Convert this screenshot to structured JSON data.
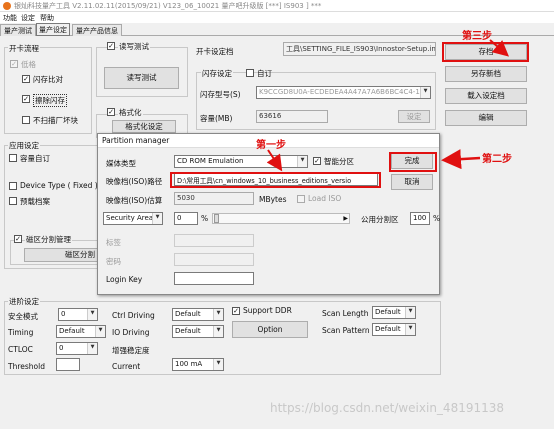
{
  "window": {
    "title": "银灿科技量产工具 V2.11.02.11(2015/09/21)  V123_06_10021 量产吧升级版           [***] IS903 ] ***"
  },
  "menu": [
    "功能",
    "设定",
    "帮助"
  ],
  "tabs": [
    "量产测试",
    "量产设定",
    "量产产品信息"
  ],
  "card_group": {
    "title": "开卡流程",
    "items": [
      {
        "label": "低格",
        "checked": true,
        "disabled": true
      },
      {
        "label": "闪存比对",
        "checked": true
      },
      {
        "label": "擦除闪存",
        "checked": true
      },
      {
        "label": "不扫描厂坏块",
        "checked": false
      }
    ]
  },
  "read_test": {
    "checkbox": "读写测试",
    "checked": true,
    "button": "读写测试"
  },
  "format": {
    "checkbox": "格式化",
    "checked": true,
    "button": "格式化设定"
  },
  "app": {
    "title": "应用设定",
    "items": [
      "容量自订",
      "Device Type ( Fixed )",
      "预载档案"
    ]
  },
  "partition": {
    "checkbox": "磁区分割管理",
    "checked": true,
    "button": "磁区分割"
  },
  "settings_file": {
    "label": "开卡设定档",
    "value": "工具\\SETTING_FILE_IS903\\Innostor-Setup.ini"
  },
  "flash": {
    "title": "闪存设定",
    "custom": "自订",
    "model_label": "闪存型号(S)",
    "model_value": "K9CCGD8U0A-ECDEDEA4A47A7A6B6BC4C4-1",
    "capacity_label": "容量(MB)",
    "capacity_value": "63616",
    "setup_button": "设定"
  },
  "right_buttons": {
    "save": "存档",
    "save_as": "另存新档",
    "load": "载入设定档",
    "edit": "编辑"
  },
  "adv": {
    "title": "进阶设定",
    "security_mode": {
      "label": "安全模式",
      "value": "0"
    },
    "timing": {
      "label": "Timing",
      "value": "Default"
    },
    "ctloc": {
      "label": "CTLOC",
      "value": "0"
    },
    "threshold": {
      "label": "Threshold",
      "value": ""
    },
    "ctrl_driving": {
      "label": "Ctrl Driving",
      "value": "Default"
    },
    "io_driving": {
      "label": "IO Driving",
      "value": "Default"
    },
    "stability": {
      "label": "增强稳定度"
    },
    "current": {
      "label": "Current",
      "value": "100 mA"
    },
    "ddr": {
      "label": "Support DDR",
      "checked": true
    },
    "option_button": "Option",
    "scan_length": {
      "label": "Scan Length",
      "value": "Default"
    },
    "scan_pattern": {
      "label": "Scan Pattern",
      "value": "Default"
    }
  },
  "dialog": {
    "title": "Partition manager",
    "media_type": {
      "label": "媒体类型",
      "value": "CD ROM Emulation"
    },
    "smart_partition": {
      "label": "智能分区",
      "checked": true
    },
    "iso_path": {
      "label": "映像档(ISO)路径",
      "value": "D:\\常用工具\\cn_windows_10_business_editions_versio"
    },
    "iso_size": {
      "label": "映像档(ISO)估算",
      "value": "5030",
      "unit": "MBytes"
    },
    "load_iso": {
      "label": "Load ISO",
      "checked": false
    },
    "area": {
      "value": "Security Area",
      "pct": "0",
      "pct_unit": "%"
    },
    "public": {
      "label": "公用分割区",
      "value": "100",
      "unit": "%"
    },
    "volume_label": "标签",
    "password": "密码",
    "login_key": "Login Key",
    "ok": "完成",
    "cancel": "取消"
  },
  "annotations": {
    "step1": "第一步",
    "step2": "第二步",
    "step3": "第三步"
  },
  "watermark": "https://blog.csdn.net/weixin_48191138"
}
